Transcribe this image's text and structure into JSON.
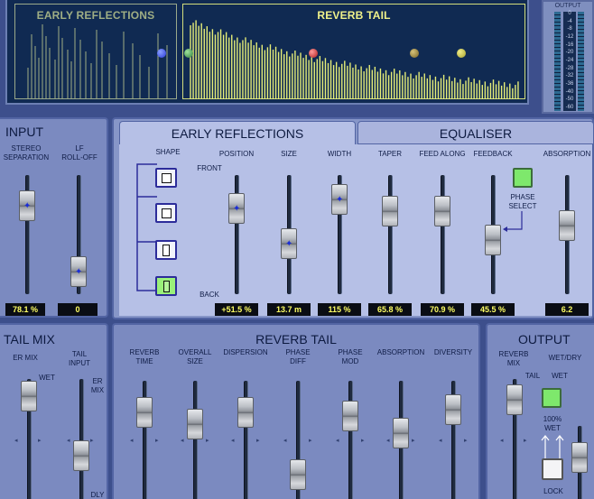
{
  "display": {
    "early_title": "EARLY REFLECTIONS",
    "tail_title": "REVERB TAIL",
    "dot_colors": [
      "#2a39d8",
      "#3d9a4a",
      "#c82a2a",
      "#8a7a34",
      "#b7b23a"
    ]
  },
  "meter": {
    "title": "OUTPUT",
    "scale": [
      "0",
      "-4",
      "-8",
      "-12",
      "-16",
      "-20",
      "-24",
      "-28",
      "-32",
      "-36",
      "-40",
      "-50",
      "-60"
    ]
  },
  "input": {
    "title": "INPUT",
    "sliders": [
      {
        "label": "STEREO\nSEPARATION",
        "value": "78.1 %",
        "level": 0.83
      },
      {
        "label": "LF\nROLL-OFF",
        "value": "0",
        "level": 0.08
      }
    ]
  },
  "tabs": {
    "early": "EARLY REFLECTIONS",
    "equaliser": "EQUALISER"
  },
  "er": {
    "shape_label": "SHAPE",
    "front_label": "FRONT",
    "back_label": "BACK",
    "phase_label": "PHASE\nSELECT",
    "sliders": [
      {
        "label": "POSITION",
        "value": "+51.5 %",
        "level": 0.8
      },
      {
        "label": "SIZE",
        "value": "13.7 m",
        "level": 0.4
      },
      {
        "label": "WIDTH",
        "value": "115 %",
        "level": 0.9
      },
      {
        "label": "TAPER",
        "value": "65.8 %",
        "level": 0.77
      },
      {
        "label": "FEED ALONG",
        "value": "70.9 %",
        "level": 0.77
      },
      {
        "label": "FEEDBACK",
        "value": "45.5 %",
        "level": 0.44
      },
      {
        "label": "ABSORPTION",
        "value": "6.2",
        "level": 0.6
      }
    ]
  },
  "tail_mix": {
    "title": "TAIL MIX",
    "er_mix": "ER MIX",
    "tail_input": "TAIL\nINPUT",
    "wet": "WET",
    "er_mix_small": "ER\nMIX",
    "dly": "DLY"
  },
  "reverb_tail": {
    "title": "REVERB TAIL",
    "sliders": [
      {
        "label": "REVERB\nTIME",
        "level": 0.82
      },
      {
        "label": "OVERALL\nSIZE",
        "level": 0.7
      },
      {
        "label": "DISPERSION",
        "level": 0.82
      },
      {
        "label": "PHASE\nDIFF",
        "level": 0.15
      },
      {
        "label": "PHASE\nMOD",
        "level": 0.78
      },
      {
        "label": "ABSORPTION",
        "level": 0.6
      },
      {
        "label": "DIVERSITY",
        "level": 0.85
      }
    ]
  },
  "output": {
    "title": "OUTPUT",
    "reverb_mix": "REVERB\nMIX",
    "wet_dry": "WET/DRY",
    "tail": "TAIL",
    "wet": "WET",
    "wet_100": "100%\nWET",
    "lock": "LOCK"
  }
}
